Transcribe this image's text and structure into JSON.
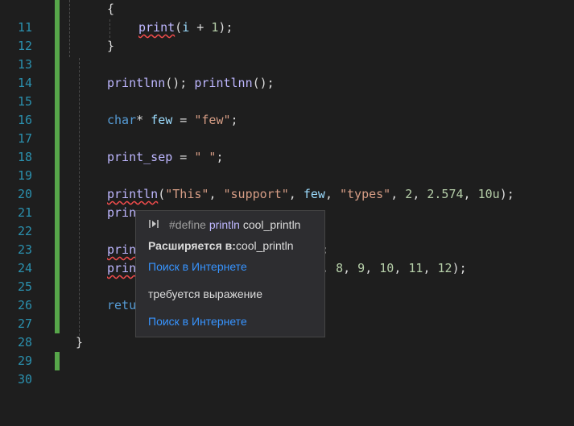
{
  "lines": [
    {
      "num": "11",
      "t": "{"
    },
    {
      "num": "12",
      "t": "print(i + 1);"
    },
    {
      "num": "13",
      "t": "}"
    },
    {
      "num": "14",
      "t": ""
    },
    {
      "num": "15",
      "t": "printlnn(); printlnn();"
    },
    {
      "num": "16",
      "t": ""
    },
    {
      "num": "17",
      "t": "char* few = \"few\";"
    },
    {
      "num": "18",
      "t": ""
    },
    {
      "num": "19",
      "t": "print_sep = \" \";"
    },
    {
      "num": "20",
      "t": ""
    },
    {
      "num": "21",
      "t": "println(\"This\", \"support\", few, \"types\", 2, 2.574, 10u);"
    },
    {
      "num": "22",
      "t": "prin"
    },
    {
      "num": "23",
      "t": ""
    },
    {
      "num": "24",
      "t": "prin"
    },
    {
      "num": "25",
      "t": "prin"
    },
    {
      "num": "26",
      "t": ""
    },
    {
      "num": "27",
      "t": "retu"
    },
    {
      "num": "28",
      "t": ""
    },
    {
      "num": "29",
      "t": "}"
    },
    {
      "num": "30",
      "t": ""
    }
  ],
  "line24_tail": ";",
  "line25_tail": ", 8, 9, 10, 11, 12);",
  "tooltip": {
    "define_kw": "#define",
    "define_name": "println",
    "define_value": "cool_println",
    "expands_label": "Расширяется в:",
    "expands_value": "cool_println",
    "search_link_1": "Поиск в Интернете",
    "error_text": "требуется выражение",
    "search_link_2": "Поиск в Интернете",
    "icon": "expand-macro-icon"
  },
  "colors": {
    "background": "#1e1e1e",
    "line_numbers": "#2b91af",
    "gutter_change": "#57a64a",
    "keyword": "#569cd6",
    "string": "#d69d85",
    "number": "#b5cea8",
    "macro": "#beb7ff",
    "link": "#3794ff"
  }
}
